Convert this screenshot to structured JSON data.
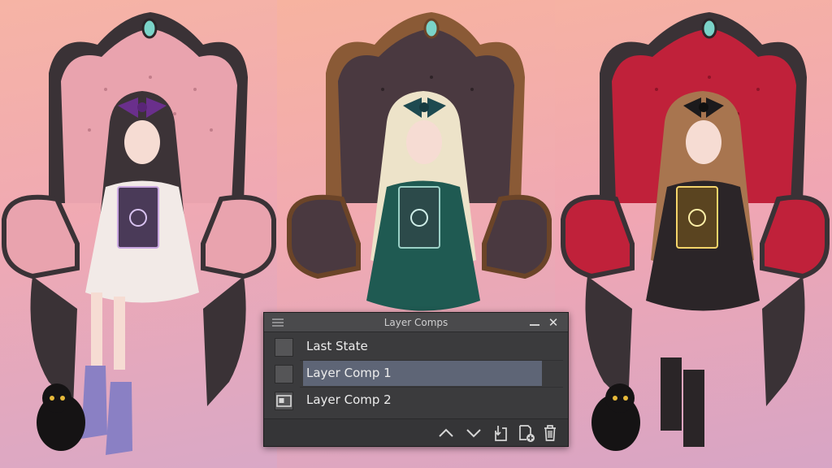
{
  "palette": {
    "title": "Layer Comps",
    "icons": {
      "menu": "menu-icon",
      "minimize": "minimize-icon",
      "close": "close-icon"
    },
    "items": [
      {
        "label": "Last State",
        "selected": false
      },
      {
        "label": "Layer Comp 1",
        "selected": true
      },
      {
        "label": "Layer Comp 2",
        "selected": false
      }
    ],
    "toolbar": [
      "move-up-icon",
      "move-down-icon",
      "apply-comp-icon",
      "new-comp-icon",
      "delete-icon"
    ]
  },
  "colors": {
    "palette_bg": "#3b3b3d",
    "selection": "#5e6576",
    "chair_pink": "#e9a3ae",
    "chair_brown": "#4a3940",
    "chair_red": "#c0213a"
  }
}
